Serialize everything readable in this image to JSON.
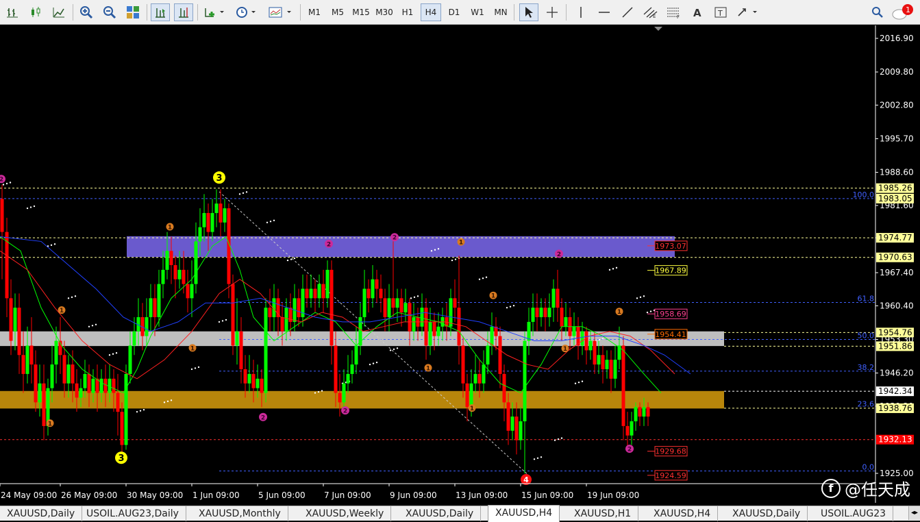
{
  "toolbar": {
    "timeframes": [
      "M1",
      "M5",
      "M15",
      "M30",
      "H1",
      "H4",
      "D1",
      "W1",
      "MN"
    ],
    "active_timeframe": "H4",
    "notification_count": "1"
  },
  "chart": {
    "symbol": "XAUUSD",
    "timeframe": "H4",
    "price_axis": [
      "2016.90",
      "2009.80",
      "2002.80",
      "1995.70",
      "1988.60",
      "1981.60",
      "1974.77",
      "1967.40",
      "1960.40",
      "1953.30",
      "1946.20",
      "1939.20",
      "1925.00"
    ],
    "time_axis": [
      "24 May 09:00",
      "26 May 09:00",
      "30 May 09:00",
      "1 Jun 09:00",
      "5 Jun 09:00",
      "7 Jun 09:00",
      "9 Jun 09:00",
      "13 Jun 09:00",
      "15 Jun 09:00",
      "19 Jun 09:00"
    ],
    "axis_price_boxes": [
      {
        "label": "1985.26",
        "bg": "#ffff99",
        "fg": "#000"
      },
      {
        "label": "1983.05",
        "bg": "#ffff99",
        "fg": "#000"
      },
      {
        "label": "1974.77",
        "bg": "#ffff99",
        "fg": "#000"
      },
      {
        "label": "1970.63",
        "bg": "#ffff99",
        "fg": "#000"
      },
      {
        "label": "1954.76",
        "bg": "#ffff99",
        "fg": "#000"
      },
      {
        "label": "1951.86",
        "bg": "#ffff99",
        "fg": "#000"
      },
      {
        "label": "1942.34",
        "bg": "#ffffff",
        "fg": "#000"
      },
      {
        "label": "1938.76",
        "bg": "#ffff99",
        "fg": "#000"
      },
      {
        "label": "1932.13",
        "bg": "#ff0000",
        "fg": "#fff"
      }
    ],
    "level_labels": [
      {
        "label": "1973.07",
        "color": "#ff3030"
      },
      {
        "label": "1967.89",
        "color": "#ffff40"
      },
      {
        "label": "1958.69",
        "color": "#ff4090"
      },
      {
        "label": "1954.41",
        "color": "#ff6a00"
      },
      {
        "label": "1929.68",
        "color": "#ff3030"
      },
      {
        "label": "1924.59",
        "color": "#ff3030"
      }
    ],
    "fib_labels": [
      "100.0",
      "61.8",
      "50.0",
      "38.2",
      "23.6",
      "0.0"
    ],
    "wave_labels_yellow": [
      "3",
      "3"
    ],
    "wave_labels_magenta": [
      "2",
      "2",
      "2",
      "2",
      "2",
      "2",
      "2"
    ],
    "wave_labels_orange": [
      "1",
      "1",
      "1",
      "1",
      "1",
      "1",
      "1",
      "1",
      "1",
      "1"
    ],
    "wave_label_red": "4",
    "colors": {
      "bull": "#00ff00",
      "bear": "#ff0000",
      "supply_zone": "#6a5acd",
      "pivot_zone": "#c8c8c8",
      "demand_zone": "#b8860b"
    }
  },
  "tabs": [
    "XAUUSD,Daily",
    "USOIL.AUG23,Daily",
    "XAUUSD,Monthly",
    "XAUUSD,Weekly",
    "XAUUSD,Daily",
    "XAUUSD,H4",
    "XAUUSD,H1",
    "XAUUSD,H4",
    "XAUUSD,Daily",
    "USOIL.AUG23"
  ],
  "active_tab_index": 5,
  "watermark": "@任天成"
}
